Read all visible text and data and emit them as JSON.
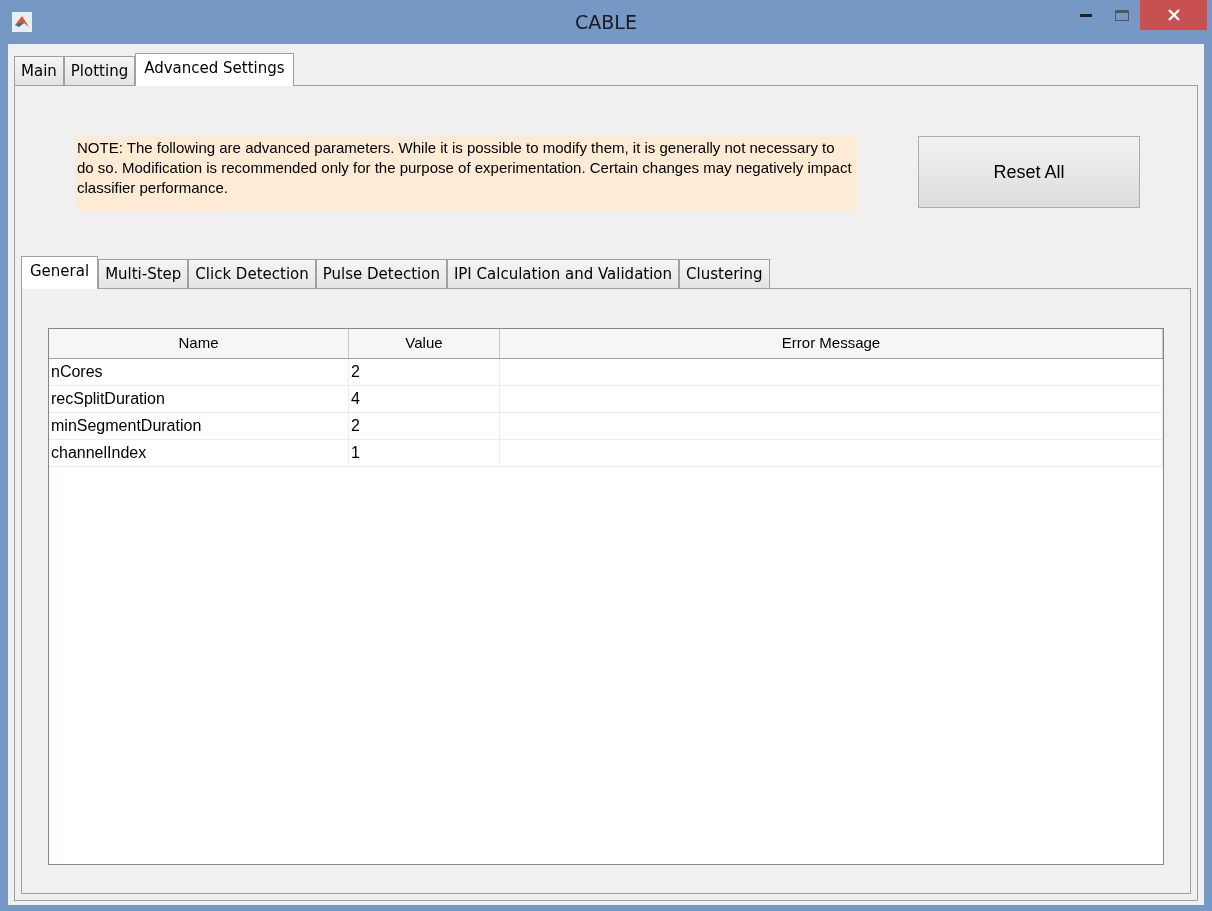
{
  "window": {
    "title": "CABLE"
  },
  "tabs": [
    {
      "label": "Main",
      "selected": false
    },
    {
      "label": "Plotting",
      "selected": false
    },
    {
      "label": "Advanced Settings",
      "selected": true
    }
  ],
  "note": "NOTE: The following are advanced parameters. While it is possible to modify them, it is generally not necessary to do so. Modification is recommended only for the purpose of experimentation. Certain changes may negatively impact classifier performance.",
  "reset_button": "Reset All",
  "subtabs": [
    {
      "label": "General",
      "selected": true
    },
    {
      "label": "Multi-Step",
      "selected": false
    },
    {
      "label": "Click Detection",
      "selected": false
    },
    {
      "label": "Pulse Detection",
      "selected": false
    },
    {
      "label": "IPI Calculation and Validation",
      "selected": false
    },
    {
      "label": "Clustering",
      "selected": false
    }
  ],
  "table": {
    "columns": [
      "Name",
      "Value",
      "Error Message"
    ],
    "rows": [
      [
        "nCores",
        "2"
      ],
      [
        "recSplitDuration",
        "4"
      ],
      [
        "minSegmentDuration",
        "2"
      ],
      [
        "channelIndex",
        "1"
      ]
    ]
  }
}
